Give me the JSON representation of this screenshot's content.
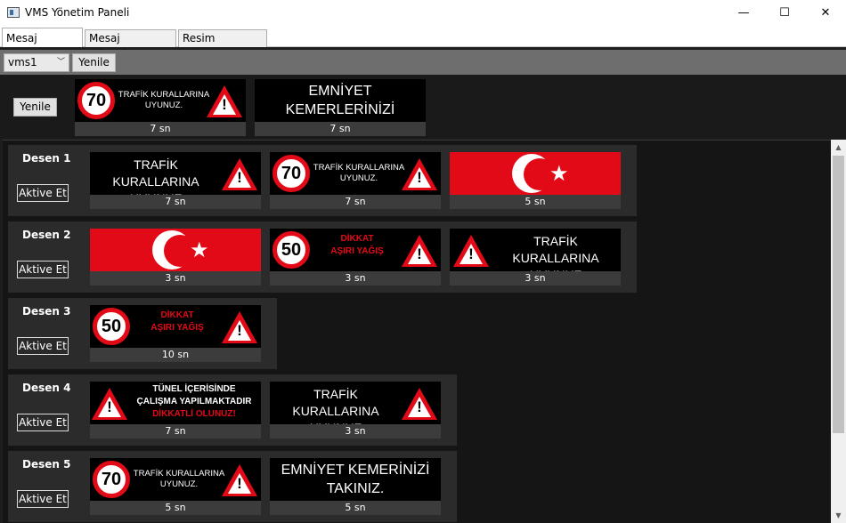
{
  "window": {
    "title": "VMS Yönetim Paneli",
    "minimize": "—",
    "maximize": "☐",
    "close": "✕"
  },
  "tabs": [
    "Mesaj Yönetimi",
    "Mesaj Düzenleme",
    "Resim Oluşturma"
  ],
  "toolbar": {
    "device": "vms1",
    "refresh": "Yenile"
  },
  "active": {
    "refresh": "Yenile",
    "tiles": [
      {
        "type": "limit70",
        "text": "TRAFİK KURALLARINA UYUNUZ.",
        "dur": "7 sn"
      },
      {
        "type": "text",
        "text": "EMNİYET KEMERLERİNİZİ TAKINIZ.",
        "dur": "7 sn"
      }
    ]
  },
  "desenler": [
    {
      "label": "Desen 1",
      "button": "Aktive Et",
      "tiles": [
        {
          "type": "kurallar",
          "text": "TRAFİK KURALLARINA UYUNUZ",
          "dur": "7 sn"
        },
        {
          "type": "limit70",
          "text": "TRAFİK KURALLARINA UYUNUZ.",
          "dur": "7 sn"
        },
        {
          "type": "flag",
          "dur": "5 sn"
        }
      ]
    },
    {
      "label": "Desen 2",
      "button": "Aktive Et",
      "tiles": [
        {
          "type": "flag",
          "dur": "3 sn"
        },
        {
          "type": "dikkat",
          "l1": "DİKKAT",
          "l2": "AŞIRI YAĞIŞ",
          "speed": "50",
          "dur": "3 sn"
        },
        {
          "type": "kurallarLeft",
          "text": "TRAFİK KURALLARINA UYUNUZ",
          "dur": "3 sn"
        }
      ]
    },
    {
      "label": "Desen 3",
      "button": "Aktive Et",
      "tiles": [
        {
          "type": "dikkat",
          "l1": "DİKKAT",
          "l2": "AŞIRI YAĞIŞ",
          "speed": "50",
          "dur": "10 sn"
        }
      ]
    },
    {
      "label": "Desen 4",
      "button": "Aktive Et",
      "tiles": [
        {
          "type": "tunel",
          "l1": "TÜNEL İÇERİSİNDE",
          "l2": "ÇALIŞMA YAPILMAKTADIR",
          "l3": "DİKKATLİ OLUNUZ!",
          "dur": "7 sn"
        },
        {
          "type": "kurallar",
          "text": "TRAFİK KURALLARINA UYUNUZ",
          "dur": "3 sn"
        }
      ]
    },
    {
      "label": "Desen 5",
      "button": "Aktive Et",
      "tiles": [
        {
          "type": "limit70",
          "text": "TRAFİK KURALLARINA UYUNUZ.",
          "dur": "5 sn"
        },
        {
          "type": "text",
          "text": "EMNİYET KEMERİNİZİ TAKINIZ.",
          "dur": "5 sn"
        }
      ]
    }
  ],
  "limit70": "70"
}
